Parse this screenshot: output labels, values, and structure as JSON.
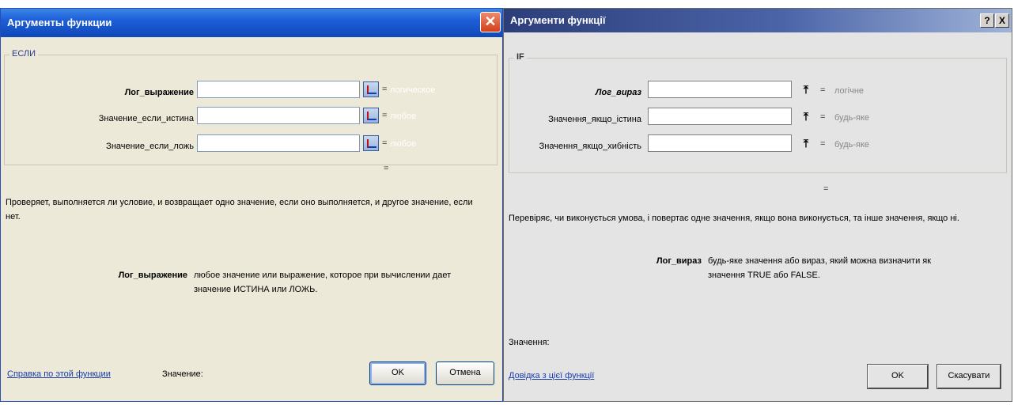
{
  "ru": {
    "title": "Аргументы функции",
    "close_glyph": "✕",
    "function_name": "ЕСЛИ",
    "args": [
      {
        "label": "Лог_выражение",
        "value_hint": "логическое"
      },
      {
        "label": "Значение_если_истина",
        "value_hint": "любое"
      },
      {
        "label": "Значение_если_ложь",
        "value_hint": "любое"
      }
    ],
    "equals": "=",
    "description": "Проверяет, выполняется ли условие, и возвращает одно значение, если оно выполняется, и другое значение, если нет.",
    "arg_desc_name": "Лог_выражение",
    "arg_desc_text": "любое значение или выражение, которое при вычислении дает значение ИСТИНА или ЛОЖЬ.",
    "help_link": "Справка по этой функции",
    "value_label": "Значение:",
    "ok_label": "OK",
    "cancel_label": "Отмена"
  },
  "ua": {
    "title": "Аргументи функції",
    "help_glyph": "?",
    "close_glyph": "X",
    "function_name": "IF",
    "args": [
      {
        "label": "Лог_вираз",
        "value_hint": "логічне"
      },
      {
        "label": "Значення_якщо_істина",
        "value_hint": "будь-яке"
      },
      {
        "label": "Значення_якщо_хибність",
        "value_hint": "будь-яке"
      }
    ],
    "ref_glyph": "⤒",
    "equals": "=",
    "description": "Перевіряє, чи виконується умова, і повертає одне значення, якщо вона виконується, та інше значення, якщо ні.",
    "arg_desc_name": "Лог_вираз",
    "arg_desc_text": "будь-яке значення або вираз, який можна визначити як значення TRUE або FALSE.",
    "value_label": "Значення:",
    "help_link": "Довідка з цієї функції",
    "ok_label": "OK",
    "cancel_label": "Скасувати"
  }
}
